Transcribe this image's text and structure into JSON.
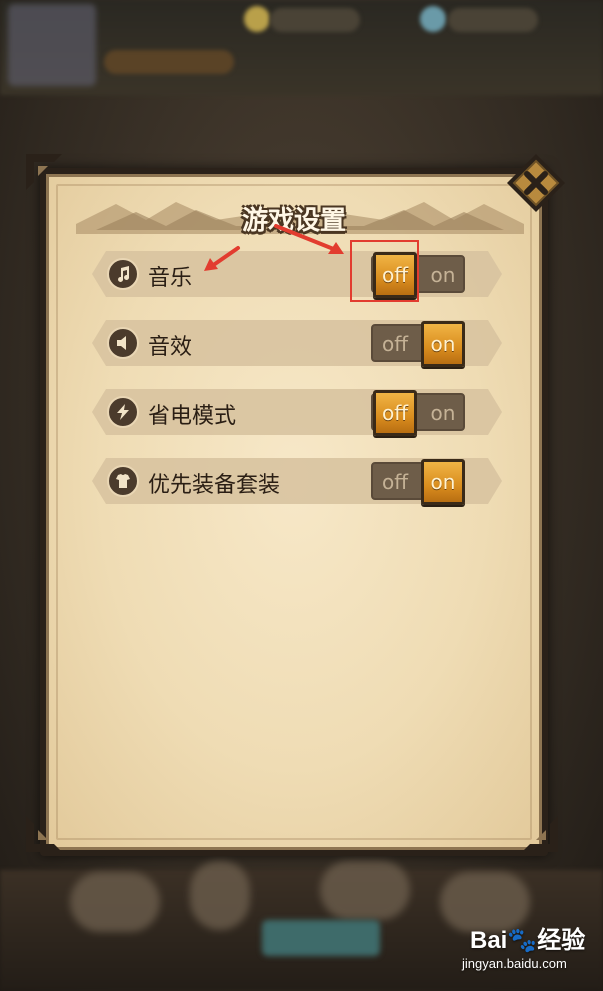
{
  "dialog": {
    "title": "游戏设置"
  },
  "settings": [
    {
      "label": "音乐",
      "icon": "music-note-icon",
      "off_label": "off",
      "on_label": "on",
      "state": "off"
    },
    {
      "label": "音效",
      "icon": "speaker-icon",
      "off_label": "off",
      "on_label": "on",
      "state": "on"
    },
    {
      "label": "省电模式",
      "icon": "lightning-icon",
      "off_label": "off",
      "on_label": "on",
      "state": "off"
    },
    {
      "label": "优先装备套装",
      "icon": "armor-icon",
      "off_label": "off",
      "on_label": "on",
      "state": "on"
    }
  ],
  "annotation": {
    "highlight_color": "#e23c2f"
  },
  "watermark": {
    "logo": "Bai🐾经验",
    "url": "jingyan.baidu.com"
  },
  "colors": {
    "toggle_active": "#e8a030",
    "panel_bg": "#f1e0bd",
    "frame": "#2a2119"
  }
}
